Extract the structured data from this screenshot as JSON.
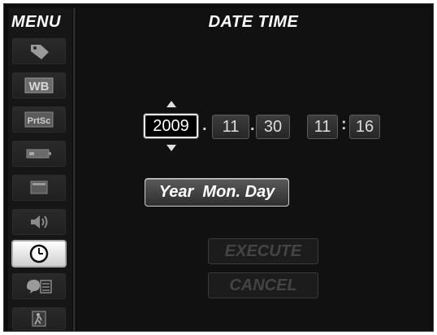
{
  "sidebar": {
    "title": "MENU",
    "items": [
      {
        "id": "tag",
        "icon": "tag-icon",
        "label": ""
      },
      {
        "id": "wb",
        "icon": "wb-icon",
        "label": "WB"
      },
      {
        "id": "prtsc",
        "icon": "print-screen-icon",
        "label": "PrtSc"
      },
      {
        "id": "battery",
        "icon": "battery-icon",
        "label": ""
      },
      {
        "id": "display",
        "icon": "display-icon",
        "label": ""
      },
      {
        "id": "sound",
        "icon": "speaker-icon",
        "label": ""
      },
      {
        "id": "clock",
        "icon": "clock-icon",
        "label": "",
        "active": true
      },
      {
        "id": "language",
        "icon": "language-icon",
        "label": ""
      },
      {
        "id": "exit",
        "icon": "exit-icon",
        "label": ""
      }
    ]
  },
  "main": {
    "title": "DATE TIME",
    "date": {
      "year": "2009",
      "month": "11",
      "day": "30",
      "separator": "."
    },
    "time": {
      "hour": "11",
      "minute": "16",
      "separator": ":"
    },
    "format_button": "Year  Mon. Day",
    "execute_button": "EXECUTE",
    "cancel_button": "CANCEL"
  },
  "colors": {
    "background": "#0d0d0d",
    "text": "#ffffff",
    "disabled": "#444444",
    "active_field_border": "#e8e8e8"
  }
}
